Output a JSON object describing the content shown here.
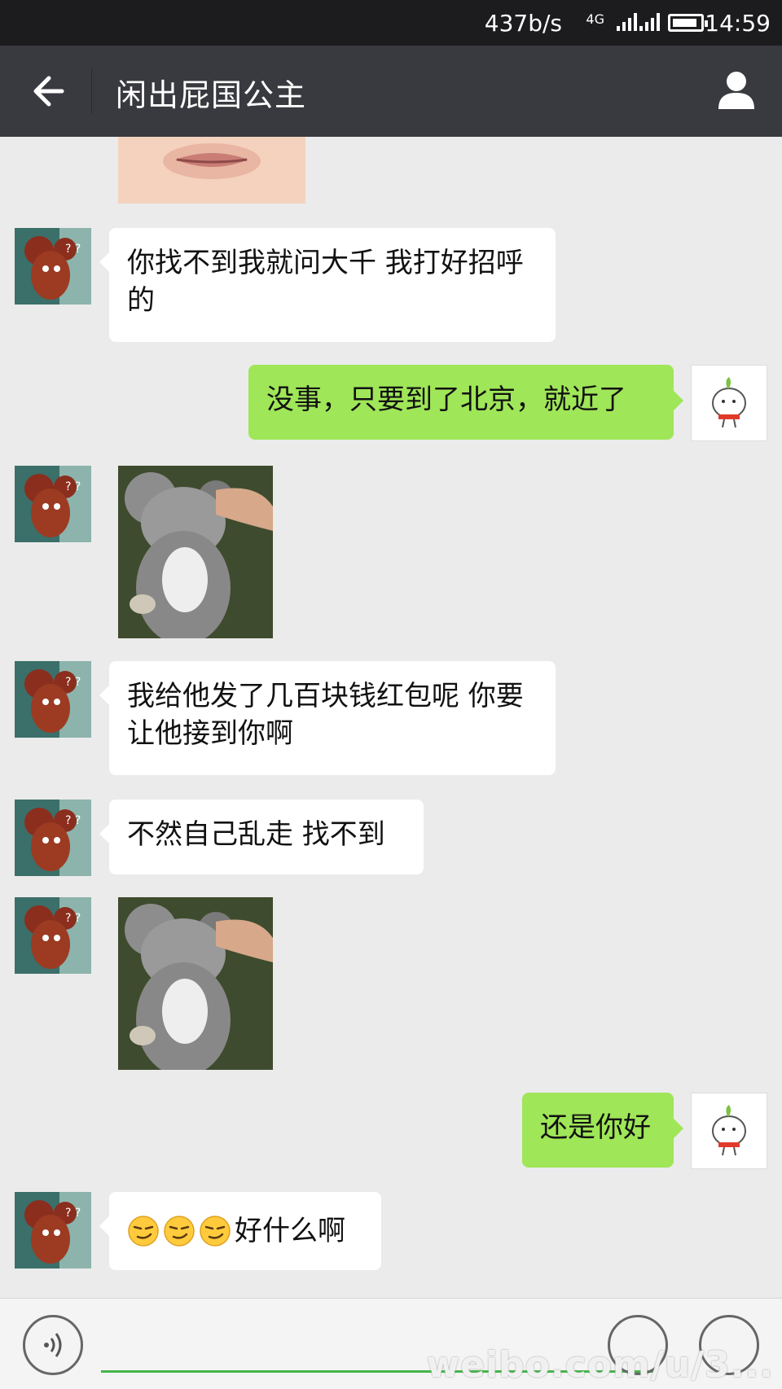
{
  "status_bar": {
    "network_speed": "437b/s",
    "network_type": "4G",
    "time": "14:59",
    "battery_level": 0.9
  },
  "header": {
    "title": "闲出屁国公主",
    "back_icon": "arrow-left-icon",
    "profile_icon": "person-icon"
  },
  "messages": [
    {
      "sender": "friend",
      "type": "text",
      "text": "你找不到我就问大千 我打好招呼的"
    },
    {
      "sender": "me",
      "type": "text",
      "text": "没事，只要到了北京，就近了"
    },
    {
      "sender": "friend",
      "type": "sticker",
      "sticker": "koala-sticker"
    },
    {
      "sender": "friend",
      "type": "text",
      "text": "我给他发了几百块钱红包呢 你要让他接到你啊"
    },
    {
      "sender": "friend",
      "type": "text",
      "text": "不然自己乱走 找不到"
    },
    {
      "sender": "friend",
      "type": "sticker",
      "sticker": "koala-sticker"
    },
    {
      "sender": "me",
      "type": "text",
      "text": "还是你好"
    },
    {
      "sender": "friend",
      "type": "text",
      "text": "好什么啊",
      "emoji_prefix": [
        "smirk-emoji",
        "smirk-emoji",
        "smirk-emoji"
      ]
    }
  ],
  "input_bar": {
    "voice_icon": "voice-icon",
    "emoji_icon": "emoji-icon",
    "plus_icon": "plus-icon"
  },
  "watermark": "weibo.com/u/3..."
}
